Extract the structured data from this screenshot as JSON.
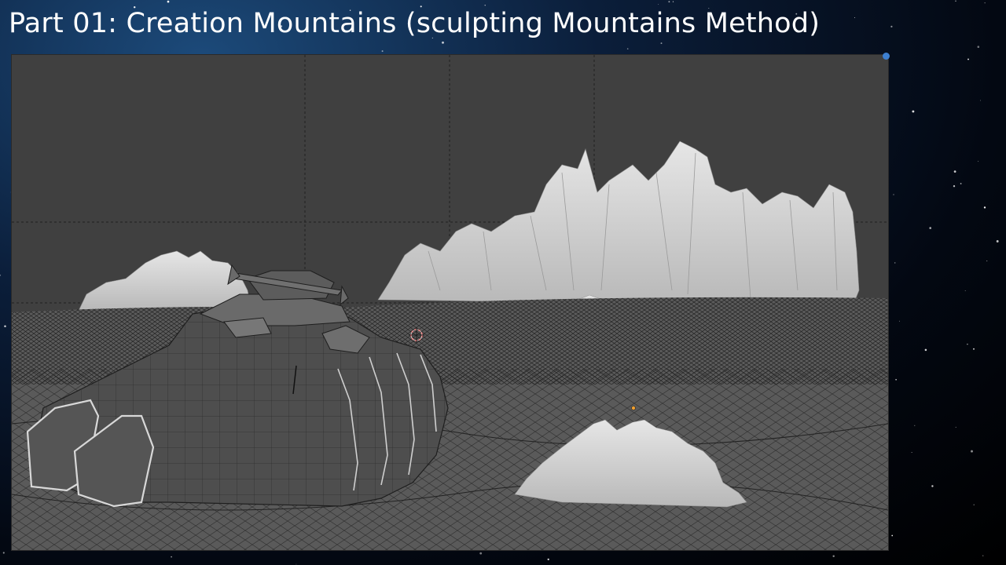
{
  "slide": {
    "title": "Part 01: Creation Mountains (sculpting Mountains Method)"
  },
  "viewport": {
    "background_color": "#404040",
    "mesh_color": "#9a9a9a",
    "mountain_color": "#d6d6d6",
    "ship_color": "#5a5a5a",
    "objects": [
      "terrain-wireframe-mesh",
      "sculpted-mountains",
      "spaceship-model",
      "3d-cursor",
      "object-origin"
    ]
  },
  "colors": {
    "accent": "#3d7fd0",
    "cursor_red": "#e03a3a",
    "origin_orange": "#f0a030"
  }
}
